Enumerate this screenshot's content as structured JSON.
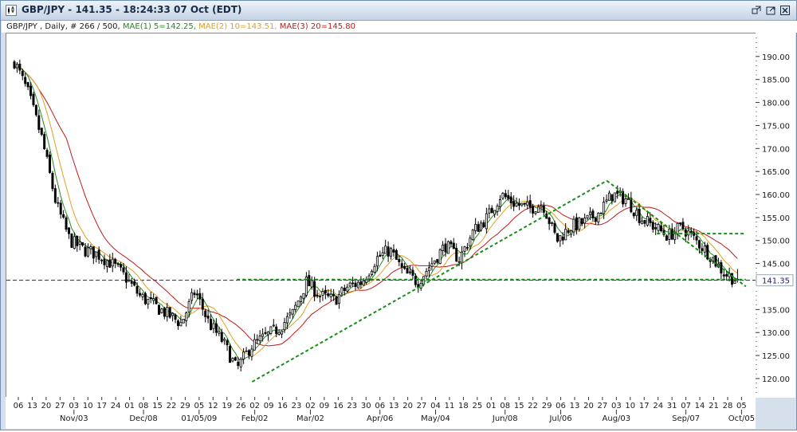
{
  "window": {
    "title": "GBP/JPY - 141.35 - 18:24:33  07 Oct (EDT)"
  },
  "legend": {
    "symbol": "GBP/JPY , Daily, # 266 / 500,",
    "mae1": "MAE(1) 5=142.25,",
    "mae2": "MAE(2) 10=143.51,",
    "mae3": "MAE(3) 20=145.80"
  },
  "colors": {
    "candle": "#000000",
    "mae1": "#1f8a1f",
    "mae2": "#e0a020",
    "mae3": "#c01818",
    "trendline": "#159015",
    "price_line": "#1a1a7a",
    "price_label_bg": "#ffffff"
  },
  "icons": [
    "app-icon",
    "restore-icon",
    "maximize-icon",
    "close-icon"
  ],
  "chart_data": {
    "type": "candlestick",
    "symbol": "GBP/JPY",
    "period": "Daily",
    "ylim": [
      116,
      195
    ],
    "yticks": [
      "190.00",
      "185.00",
      "180.00",
      "175.00",
      "170.00",
      "165.00",
      "160.00",
      "155.00",
      "150.00",
      "145.00",
      "135.00",
      "130.00",
      "125.00",
      "120.00"
    ],
    "ytick_values": [
      190,
      185,
      180,
      175,
      170,
      165,
      160,
      155,
      150,
      145,
      135,
      130,
      125,
      120
    ],
    "current_price": 141.35,
    "current_price_label": "141.35",
    "x_day_labels": [
      "06",
      "13",
      "20",
      "27",
      "03",
      "10",
      "17",
      "24",
      "01",
      "08",
      "15",
      "22",
      "29",
      "05",
      "12",
      "19",
      "26",
      "02",
      "09",
      "16",
      "23",
      "02",
      "09",
      "16",
      "23",
      "30",
      "06",
      "13",
      "20",
      "27",
      "04",
      "11",
      "18",
      "25",
      "01",
      "08",
      "15",
      "22",
      "29",
      "06",
      "13",
      "20",
      "27",
      "03",
      "10",
      "17",
      "24",
      "31",
      "07",
      "14",
      "21",
      "28",
      "05"
    ],
    "x_month_labels": [
      {
        "label": "Nov/03",
        "index": 4
      },
      {
        "label": "Dec/08",
        "index": 9
      },
      {
        "label": "01/05/09",
        "index": 13
      },
      {
        "label": "Feb/02",
        "index": 17
      },
      {
        "label": "Mar/02",
        "index": 21
      },
      {
        "label": "Apr/06",
        "index": 26
      },
      {
        "label": "May/04",
        "index": 30
      },
      {
        "label": "Jun/08",
        "index": 35
      },
      {
        "label": "Jul/06",
        "index": 39
      },
      {
        "label": "Aug/03",
        "index": 43
      },
      {
        "label": "Sep/07",
        "index": 48
      },
      {
        "label": "Oct/05",
        "index": 52
      }
    ],
    "anchors": [
      [
        0,
        189
      ],
      [
        1,
        182
      ],
      [
        2,
        172
      ],
      [
        3,
        158
      ],
      [
        4,
        150
      ],
      [
        5,
        148
      ],
      [
        6,
        147
      ],
      [
        7,
        145
      ],
      [
        8,
        142
      ],
      [
        9,
        138
      ],
      [
        10,
        136
      ],
      [
        11,
        134
      ],
      [
        12,
        132
      ],
      [
        13,
        139
      ],
      [
        14,
        132
      ],
      [
        15,
        128
      ],
      [
        16,
        122
      ],
      [
        17,
        127
      ],
      [
        18,
        129
      ],
      [
        19,
        131
      ],
      [
        20,
        134
      ],
      [
        21,
        141
      ],
      [
        22,
        138
      ],
      [
        23,
        137
      ],
      [
        24,
        140
      ],
      [
        25,
        141
      ],
      [
        26,
        146
      ],
      [
        27,
        148
      ],
      [
        28,
        143
      ],
      [
        29,
        141
      ],
      [
        30,
        145
      ],
      [
        31,
        149
      ],
      [
        32,
        146
      ],
      [
        33,
        152
      ],
      [
        34,
        155
      ],
      [
        35,
        160
      ],
      [
        36,
        158
      ],
      [
        37,
        157
      ],
      [
        38,
        158
      ],
      [
        39,
        150
      ],
      [
        40,
        153
      ],
      [
        41,
        154
      ],
      [
        42,
        156
      ],
      [
        43,
        160
      ],
      [
        44,
        159
      ],
      [
        45,
        155
      ],
      [
        46,
        153
      ],
      [
        47,
        151
      ],
      [
        48,
        153
      ],
      [
        49,
        150
      ],
      [
        50,
        147
      ],
      [
        51,
        143
      ],
      [
        52,
        141.35
      ]
    ],
    "mae_last": {
      "mae1": 142.25,
      "mae2": 143.51,
      "mae3": 145.8
    },
    "trendlines": [
      {
        "from": [
          17.1,
          119.3
        ],
        "to": [
          42.6,
          163
        ]
      },
      {
        "from": [
          42.6,
          163
        ],
        "to": [
          52.6,
          140
        ]
      },
      {
        "from": [
          46.2,
          151.5
        ],
        "to": [
          52.5,
          151.5
        ]
      },
      {
        "from": [
          16.0,
          141.5
        ],
        "to": [
          52.6,
          141.5
        ]
      }
    ]
  }
}
